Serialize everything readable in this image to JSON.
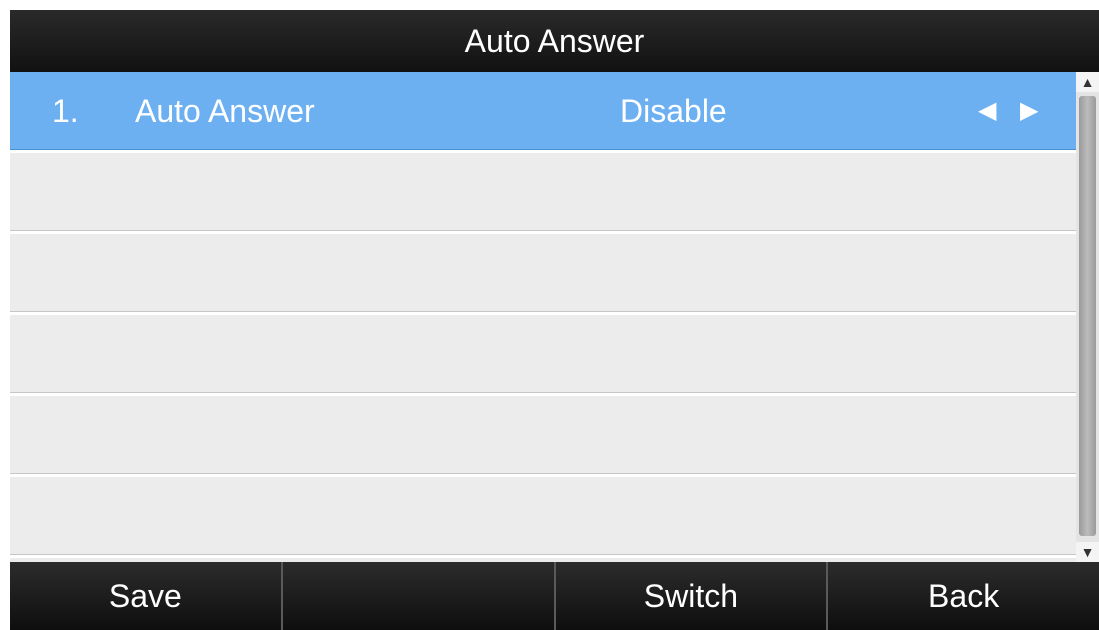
{
  "title": "Auto Answer",
  "list": {
    "items": [
      {
        "number": "1.",
        "label": "Auto Answer",
        "value": "Disable",
        "prev_arrow": "◀",
        "next_arrow": "▶"
      }
    ],
    "empty_rows": 5
  },
  "scrollbar": {
    "up_icon": "▲",
    "down_icon": "▼"
  },
  "softkeys": [
    "Save",
    "",
    "Switch",
    "Back"
  ],
  "colors": {
    "selected_row": "#6cb0f2",
    "bar_background": "#111111",
    "list_background": "#ececec"
  }
}
